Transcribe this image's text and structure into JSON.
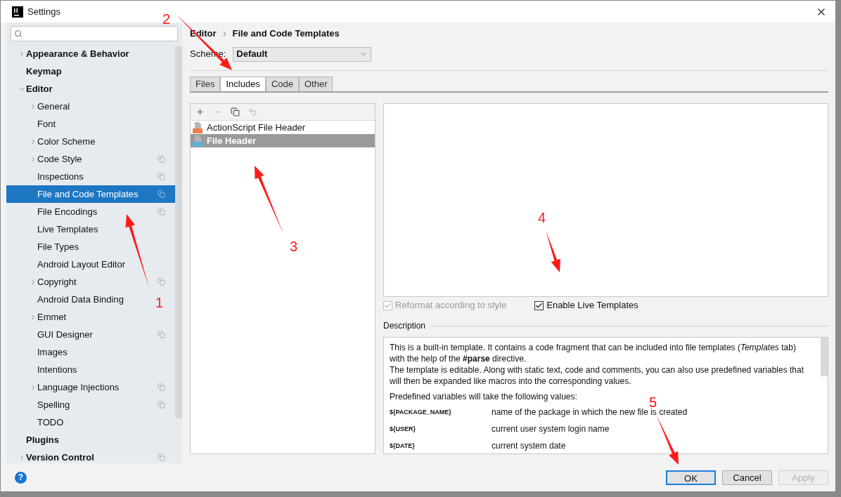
{
  "window": {
    "title": "Settings"
  },
  "sidebar": {
    "items": [
      {
        "label": "Appearance & Behavior",
        "kind": "folder",
        "expanded": false,
        "bold": true,
        "selected": false,
        "project_level": false
      },
      {
        "label": "Keymap",
        "kind": "leaf",
        "bold": true,
        "selected": false,
        "project_level": false
      },
      {
        "label": "Editor",
        "kind": "folder",
        "expanded": true,
        "bold": true,
        "selected": false,
        "project_level": false,
        "children": [
          {
            "label": "General",
            "kind": "folder",
            "expanded": false,
            "bold": false,
            "selected": false,
            "project_level": false
          },
          {
            "label": "Font",
            "kind": "leaf",
            "bold": false,
            "selected": false,
            "project_level": false
          },
          {
            "label": "Color Scheme",
            "kind": "folder",
            "expanded": false,
            "bold": false,
            "selected": false,
            "project_level": false
          },
          {
            "label": "Code Style",
            "kind": "folder",
            "expanded": false,
            "bold": false,
            "selected": false,
            "project_level": true
          },
          {
            "label": "Inspections",
            "kind": "leaf",
            "bold": false,
            "selected": false,
            "project_level": true
          },
          {
            "label": "File and Code Templates",
            "kind": "leaf",
            "bold": false,
            "selected": true,
            "project_level": true
          },
          {
            "label": "File Encodings",
            "kind": "leaf",
            "bold": false,
            "selected": false,
            "project_level": true
          },
          {
            "label": "Live Templates",
            "kind": "leaf",
            "bold": false,
            "selected": false,
            "project_level": false
          },
          {
            "label": "File Types",
            "kind": "leaf",
            "bold": false,
            "selected": false,
            "project_level": false
          },
          {
            "label": "Android Layout Editor",
            "kind": "leaf",
            "bold": false,
            "selected": false,
            "project_level": false
          },
          {
            "label": "Copyright",
            "kind": "folder",
            "expanded": false,
            "bold": false,
            "selected": false,
            "project_level": true
          },
          {
            "label": "Android Data Binding",
            "kind": "leaf",
            "bold": false,
            "selected": false,
            "project_level": false
          },
          {
            "label": "Emmet",
            "kind": "folder",
            "expanded": false,
            "bold": false,
            "selected": false,
            "project_level": false
          },
          {
            "label": "GUI Designer",
            "kind": "leaf",
            "bold": false,
            "selected": false,
            "project_level": true
          },
          {
            "label": "Images",
            "kind": "leaf",
            "bold": false,
            "selected": false,
            "project_level": false
          },
          {
            "label": "Intentions",
            "kind": "leaf",
            "bold": false,
            "selected": false,
            "project_level": false
          },
          {
            "label": "Language Injections",
            "kind": "folder",
            "expanded": false,
            "bold": false,
            "selected": false,
            "project_level": true
          },
          {
            "label": "Spelling",
            "kind": "leaf",
            "bold": false,
            "selected": false,
            "project_level": true
          },
          {
            "label": "TODO",
            "kind": "leaf",
            "bold": false,
            "selected": false,
            "project_level": false
          }
        ]
      },
      {
        "label": "Plugins",
        "kind": "leaf",
        "bold": true,
        "selected": false,
        "project_level": false
      },
      {
        "label": "Version Control",
        "kind": "folder",
        "expanded": false,
        "bold": true,
        "selected": false,
        "project_level": true
      }
    ]
  },
  "breadcrumb": [
    "Editor",
    "File and Code Templates"
  ],
  "scheme": {
    "label": "Scheme:",
    "value": "Default"
  },
  "tabs": [
    {
      "label": "Files",
      "selected": false
    },
    {
      "label": "Includes",
      "selected": true
    },
    {
      "label": "Code",
      "selected": false
    },
    {
      "label": "Other",
      "selected": false
    }
  ],
  "toolbar": [
    {
      "kind": "add",
      "disabled": false
    },
    {
      "kind": "remove",
      "disabled": true
    },
    {
      "kind": "copy",
      "disabled": false
    },
    {
      "kind": "reset",
      "disabled": true
    }
  ],
  "templates": [
    {
      "label": "ActionScript File Header",
      "kind": "actionscript",
      "selected": false
    },
    {
      "label": "File Header",
      "kind": "java",
      "selected": true
    }
  ],
  "options": [
    {
      "label": "Reformat according to style",
      "checked": true,
      "disabled": true
    },
    {
      "label": "Enable Live Templates",
      "checked": true,
      "disabled": false
    }
  ],
  "description": {
    "title": "Description",
    "paragraphs": [
      "This is a built-in template. It contains a code fragment that can be included into file templates (*Templates* tab) with the help of the **#parse** directive.",
      "The template is editable. Along with static text, code and comments, you can also use predefined variables that will then be expanded like macros into the corresponding values."
    ],
    "variables_intro": "Predefined variables will take the following values:",
    "variables": [
      {
        "name": "${PACKAGE_NAME}",
        "meaning": "name of the package in which the new file is created"
      },
      {
        "name": "${USER}",
        "meaning": "current user system login name"
      },
      {
        "name": "${DATE}",
        "meaning": "current system date"
      }
    ]
  },
  "help": {
    "label": "?"
  },
  "buttons": [
    {
      "label": "OK",
      "kind": "default",
      "disabled": false
    },
    {
      "label": "Cancel",
      "kind": "normal",
      "disabled": false
    },
    {
      "label": "Apply",
      "kind": "normal",
      "disabled": true
    }
  ],
  "annotations": [
    {
      "label": "1"
    },
    {
      "label": "2"
    },
    {
      "label": "3"
    },
    {
      "label": "4"
    },
    {
      "label": "5"
    }
  ]
}
